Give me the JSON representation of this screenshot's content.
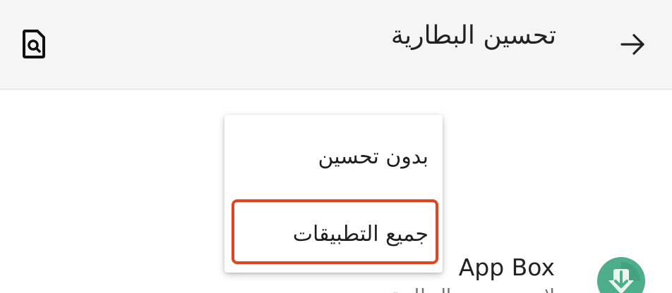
{
  "appbar": {
    "title": "تحسين البطارية",
    "back_icon": "arrow-right-icon",
    "action_icon": "search-document-icon"
  },
  "dropdown_menu": {
    "items": [
      {
        "label": "بدون تحسين"
      },
      {
        "label": "جميع التطبيقات"
      }
    ],
    "highlighted_item": "جميع التطبيقات",
    "highlight_color": "#e0451f"
  },
  "app_list": {
    "items": [
      {
        "name": "App Box",
        "subtitle": "لا يتم تحسين البطارية",
        "icon": "app-box-icon",
        "icon_color": "#4caf8a"
      }
    ]
  },
  "colors": {
    "appbar_bg": "#f5f5f5",
    "text_primary": "#222222"
  }
}
